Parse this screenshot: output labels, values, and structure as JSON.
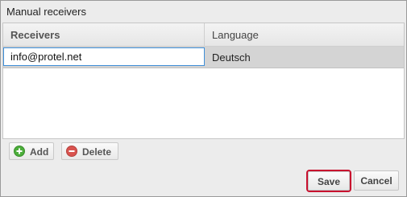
{
  "dialog": {
    "title": "Manual receivers"
  },
  "grid": {
    "columns": [
      "Receivers",
      "Language"
    ],
    "rows": [
      {
        "receiver": "info@protel.net",
        "language": "Deutsch"
      }
    ]
  },
  "toolbar": {
    "add_label": "Add",
    "delete_label": "Delete",
    "add_icon": "plus-circle-green-icon",
    "delete_icon": "minus-circle-red-icon"
  },
  "footer": {
    "save_label": "Save",
    "cancel_label": "Cancel"
  },
  "colors": {
    "selected_row": "#d4d4d4",
    "focus_border": "#3f8fd8",
    "save_highlight": "#c8102e",
    "add_icon_color": "#4cae3b",
    "delete_icon_color": "#d9534f"
  }
}
